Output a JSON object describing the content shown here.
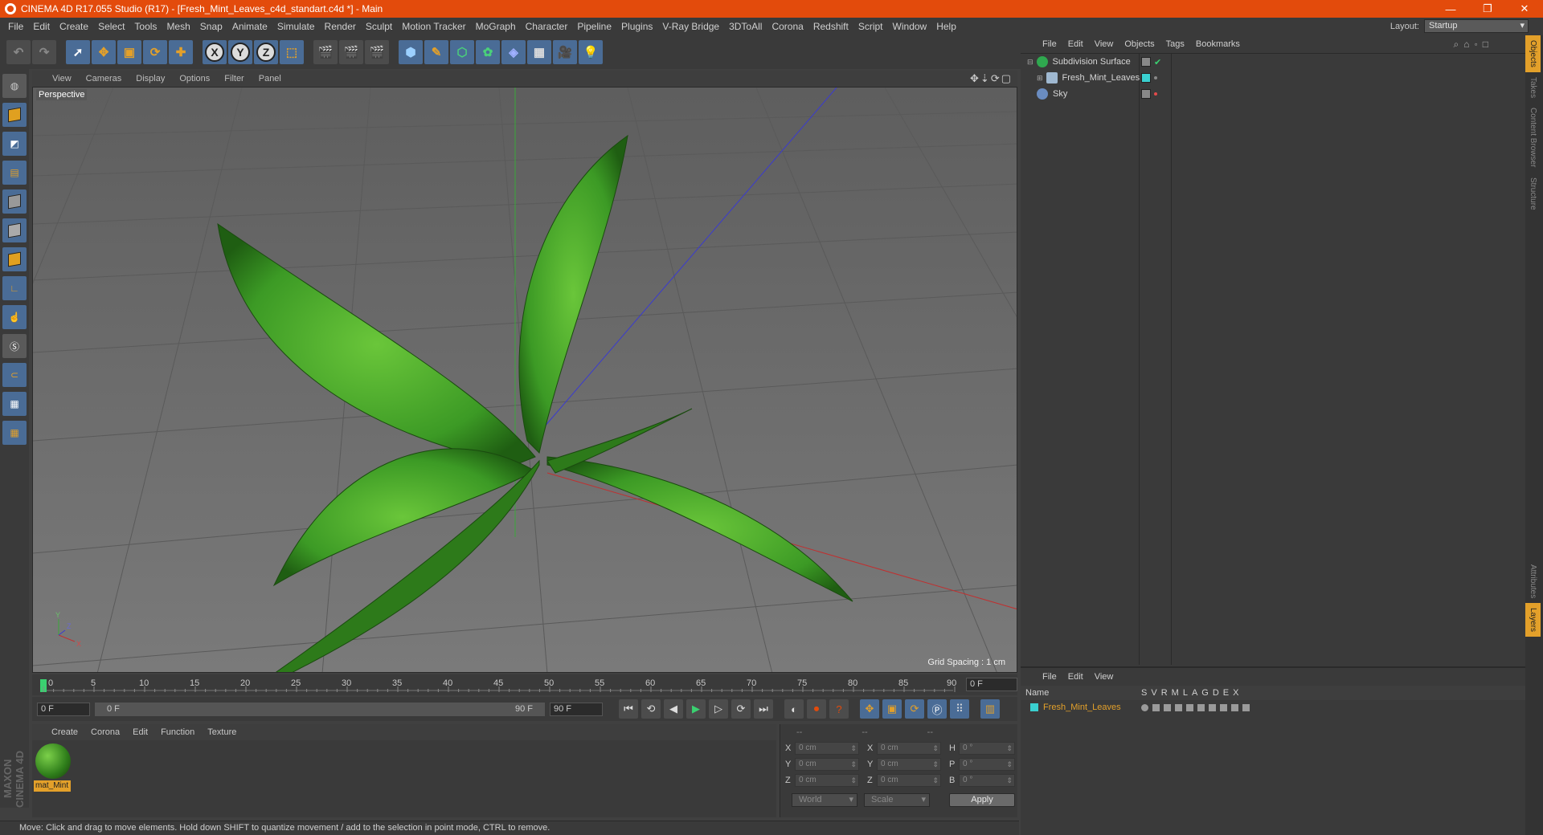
{
  "window": {
    "title": "CINEMA 4D R17.055 Studio (R17) - [Fresh_Mint_Leaves_c4d_standart.c4d *] - Main",
    "controls": [
      "minimize-icon",
      "restore-icon",
      "close-icon"
    ]
  },
  "menubar": {
    "items": [
      "File",
      "Edit",
      "Create",
      "Select",
      "Tools",
      "Mesh",
      "Snap",
      "Animate",
      "Simulate",
      "Render",
      "Sculpt",
      "Motion Tracker",
      "MoGraph",
      "Character",
      "Pipeline",
      "Plugins",
      "V-Ray Bridge",
      "3DToAll",
      "Corona",
      "Redshift",
      "Script",
      "Window",
      "Help"
    ],
    "layout_label": "Layout:",
    "layout_value": "Startup"
  },
  "viewport": {
    "menu": [
      "View",
      "Cameras",
      "Display",
      "Options",
      "Filter",
      "Panel"
    ],
    "camera_label": "Perspective",
    "grid_spacing": "Grid Spacing : 1 cm",
    "axis_labels": {
      "y": "Y",
      "x": "X",
      "z": "Z"
    }
  },
  "timeline": {
    "ticks": [
      "0",
      "5",
      "10",
      "15",
      "20",
      "25",
      "30",
      "35",
      "40",
      "45",
      "50",
      "55",
      "60",
      "65",
      "70",
      "75",
      "80",
      "85",
      "90"
    ],
    "current_frame": "0 F",
    "start_frame": "0 F",
    "range_start": "0 F",
    "range_end": "90 F",
    "end_frame": "90 F"
  },
  "material_manager": {
    "menu": [
      "Create",
      "Corona",
      "Edit",
      "Function",
      "Texture"
    ],
    "materials": [
      {
        "name": "mat_Mint"
      }
    ]
  },
  "coordinates": {
    "header": [
      "--",
      "--",
      "--"
    ],
    "rows": [
      {
        "pos_label": "X",
        "pos": "0 cm",
        "size_label": "X",
        "size": "0 cm",
        "rot_label": "H",
        "rot": "0 °"
      },
      {
        "pos_label": "Y",
        "pos": "0 cm",
        "size_label": "Y",
        "size": "0 cm",
        "rot_label": "P",
        "rot": "0 °"
      },
      {
        "pos_label": "Z",
        "pos": "0 cm",
        "size_label": "Z",
        "size": "0 cm",
        "rot_label": "B",
        "rot": "0 °"
      }
    ],
    "space": "World",
    "mode": "Scale",
    "apply_label": "Apply"
  },
  "object_manager": {
    "menu": [
      "File",
      "Edit",
      "View",
      "Objects",
      "Tags",
      "Bookmarks"
    ],
    "objects": [
      {
        "name": "Subdivision Surface",
        "color": "#2fa84f"
      },
      {
        "name": "Fresh_Mint_Leaves",
        "color": "#9fb8d0"
      },
      {
        "name": "Sky",
        "color": "#6a8cc0"
      }
    ]
  },
  "layer_manager": {
    "menu": [
      "File",
      "Edit",
      "View"
    ],
    "name_header": "Name",
    "columns": [
      "S",
      "V",
      "R",
      "M",
      "L",
      "A",
      "G",
      "D",
      "E",
      "X"
    ],
    "layers": [
      {
        "name": "Fresh_Mint_Leaves",
        "color": "#3ad0d0"
      }
    ]
  },
  "side_tabs": [
    "Objects",
    "Takes",
    "Content Browser",
    "Structure",
    "Attributes",
    "Layers"
  ],
  "status": "Move: Click and drag to move elements. Hold down SHIFT to quantize movement / add to the selection in point mode, CTRL to remove.",
  "branding": "MAXON CINEMA 4D",
  "colors": {
    "accent": "#e34b0c",
    "highlight": "#e3a02a",
    "leaf": "#3c9a25"
  }
}
